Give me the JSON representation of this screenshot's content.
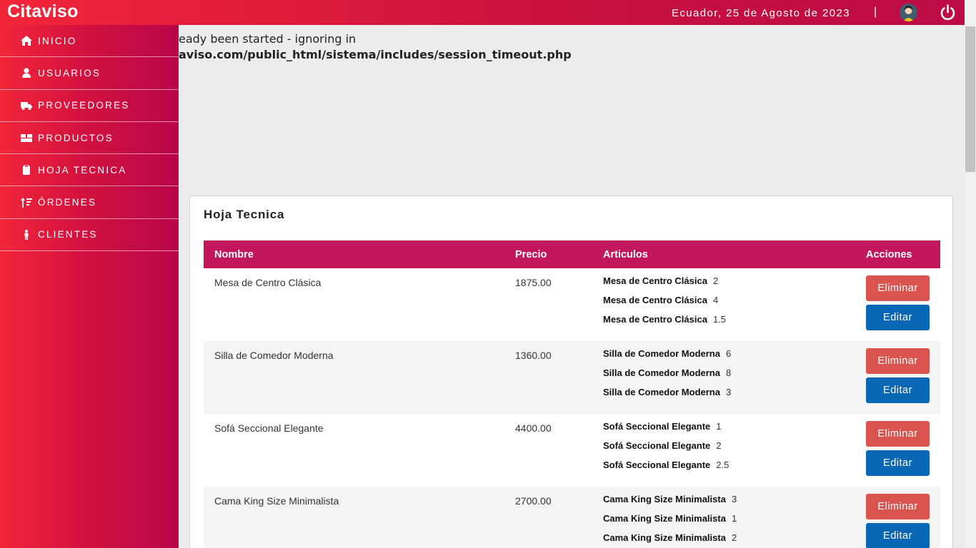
{
  "header": {
    "brand": "Citaviso",
    "date": "Ecuador, 25 de Agosto de 2023",
    "separator": "|",
    "avatar_icon": "user-avatar-icon",
    "power_icon": "power-icon"
  },
  "sidebar": {
    "items": [
      {
        "label": "INICIO",
        "icon": "home-icon"
      },
      {
        "label": "USUARIOS",
        "icon": "user-icon"
      },
      {
        "label": "PROVEEDORES",
        "icon": "truck-icon"
      },
      {
        "label": "PRODUCTOS",
        "icon": "boxes-icon"
      },
      {
        "label": "HOJA TECNICA",
        "icon": "clipboard-icon"
      },
      {
        "label": "ÓRDENES",
        "icon": "sort-icon"
      },
      {
        "label": "CLIENTES",
        "icon": "person-icon"
      }
    ]
  },
  "warning": {
    "line1": "eady been started - ignoring in",
    "line2": "aviso.com/public_html/sistema/includes/session_timeout.php"
  },
  "card": {
    "title": "Hoja Tecnica",
    "columns": {
      "name": "Nombre",
      "price": "Precio",
      "articles": "Articulos",
      "actions": "Acciones"
    },
    "delete_label": "Eliminar",
    "edit_label": "Editar",
    "rows": [
      {
        "name": "Mesa de Centro Clásica",
        "price": "1875.00",
        "articles": [
          {
            "name": "Mesa de Centro Clásica",
            "qty": "2"
          },
          {
            "name": "Mesa de Centro Clásica",
            "qty": "4"
          },
          {
            "name": "Mesa de Centro Clásica",
            "qty": "1.5"
          }
        ]
      },
      {
        "name": "Silla de Comedor Moderna",
        "price": "1360.00",
        "articles": [
          {
            "name": "Silla de Comedor Moderna",
            "qty": "6"
          },
          {
            "name": "Silla de Comedor Moderna",
            "qty": "8"
          },
          {
            "name": "Silla de Comedor Moderna",
            "qty": "3"
          }
        ]
      },
      {
        "name": "Sofá Seccional Elegante",
        "price": "4400.00",
        "articles": [
          {
            "name": "Sofá Seccional Elegante",
            "qty": "1"
          },
          {
            "name": "Sofá Seccional Elegante",
            "qty": "2"
          },
          {
            "name": "Sofá Seccional Elegante",
            "qty": "2.5"
          }
        ]
      },
      {
        "name": "Cama King Size Minimalista",
        "price": "2700.00",
        "articles": [
          {
            "name": "Cama King Size Minimalista",
            "qty": "3"
          },
          {
            "name": "Cama King Size Minimalista",
            "qty": "1"
          },
          {
            "name": "Cama King Size Minimalista",
            "qty": "2"
          }
        ]
      }
    ]
  }
}
